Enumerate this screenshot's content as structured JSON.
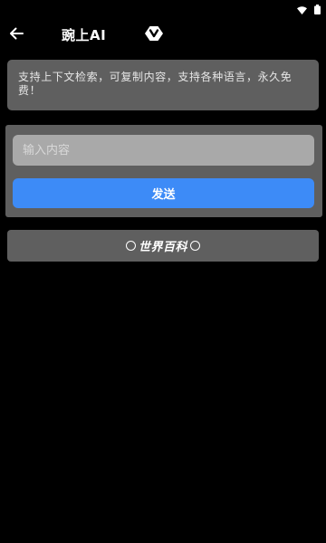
{
  "status_bar": {
    "icons": [
      "wifi-icon",
      "battery-icon"
    ]
  },
  "app_bar": {
    "back_icon": "arrow-left-icon",
    "title": "豌上AI",
    "action_icon": "chevron-diamond-icon"
  },
  "intro": {
    "text": "支持上下文检索，可复制内容，支持各种语言，永久免费！"
  },
  "chat": {
    "input_value": "",
    "input_placeholder": "输入内容",
    "send_label": "发送"
  },
  "wiki_button": {
    "label": "世界百科",
    "decor_icon": "ring-icon"
  },
  "colors": {
    "background": "#000000",
    "panel": "#5f5f5f",
    "input": "#a9a9a9",
    "accent": "#3d8bf7",
    "text": "#ffffff"
  }
}
